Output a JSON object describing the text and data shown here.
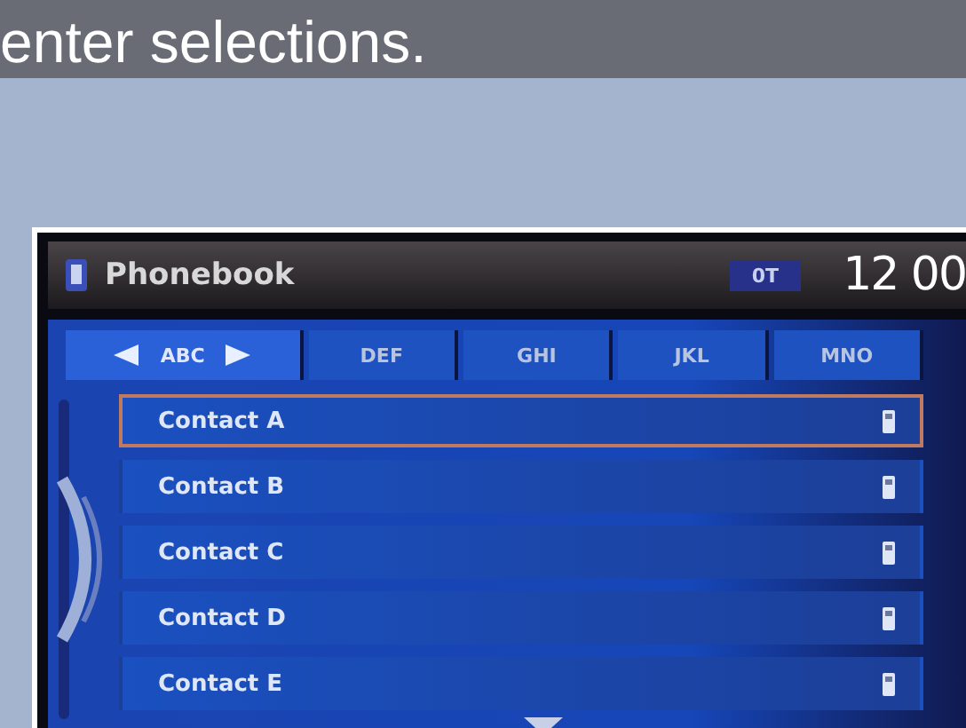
{
  "caption": "enter selections.",
  "screen": {
    "title": "Phonebook",
    "indicator": "0T",
    "clock": "12 00",
    "tabs": [
      {
        "label": "ABC",
        "selected": true
      },
      {
        "label": "DEF",
        "selected": false
      },
      {
        "label": "GHI",
        "selected": false
      },
      {
        "label": "JKL",
        "selected": false
      },
      {
        "label": "MNO",
        "selected": false
      }
    ],
    "contacts": [
      {
        "name": "Contact A",
        "selected": true
      },
      {
        "name": "Contact B",
        "selected": false
      },
      {
        "name": "Contact C",
        "selected": false
      },
      {
        "name": "Contact D",
        "selected": false
      },
      {
        "name": "Contact E",
        "selected": false
      }
    ]
  }
}
